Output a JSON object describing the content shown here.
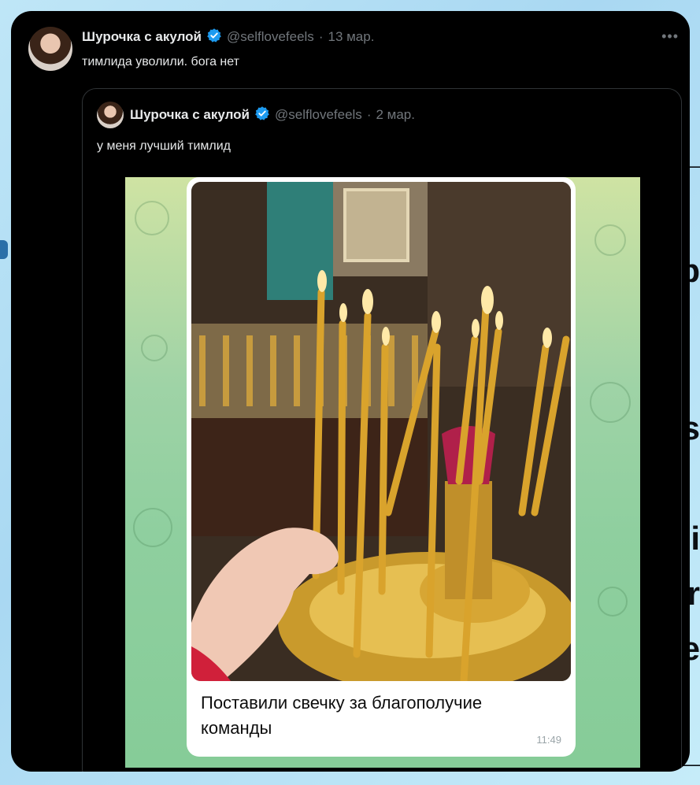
{
  "tweet": {
    "author_name": "Шурочка с акулой",
    "handle": "@selflovefeels",
    "separator": "·",
    "date": "13 мар.",
    "text": "тимлида уволили. бога нет",
    "more_icon": "more-horizontal-icon"
  },
  "quoted_tweet": {
    "author_name": "Шурочка с акулой",
    "handle": "@selflovefeels",
    "separator": "·",
    "date": "2 мар.",
    "text": "у меня лучший тимлид",
    "media": {
      "message_caption": "Поставили свечку за благополучие команды",
      "message_time": "11:49"
    }
  },
  "colors": {
    "card_bg": "#000000",
    "text_primary": "#e7e9ea",
    "text_secondary": "#71767b",
    "verified_blue": "#1d9bf0",
    "telegram_wallpaper": "#8fcf9f"
  }
}
